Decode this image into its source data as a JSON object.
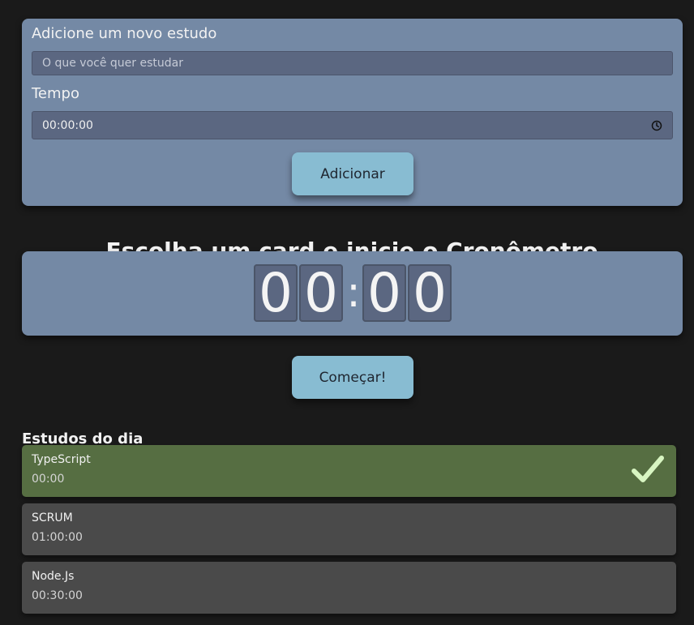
{
  "form": {
    "study_label": "Adicione um novo estudo",
    "study_placeholder": "O que você quer estudar",
    "time_label": "Tempo",
    "time_value": "00:00:00",
    "add_button": "Adicionar"
  },
  "timer": {
    "title": "Escolha um card e inicie o Cronômetro",
    "digits": [
      "0",
      "0",
      "0",
      "0"
    ],
    "separator": ":",
    "start_button": "Começar!"
  },
  "studies": {
    "title": "Estudos do dia",
    "items": [
      {
        "name": "TypeScript",
        "time": "00:00",
        "completed": true
      },
      {
        "name": "SCRUM",
        "time": "01:00:00",
        "completed": false
      },
      {
        "name": "Node.Js",
        "time": "00:30:00",
        "completed": false
      }
    ]
  },
  "colors": {
    "background": "#1a1a1a",
    "card": "#7489a5",
    "input": "#5b6781",
    "button": "#88bcd2",
    "completed_item": "#566e42",
    "item": "#4a4a4a",
    "checkmark": "#d8f5c2"
  },
  "icons": {
    "time_input": "clock-icon",
    "completed_item": "check-icon"
  }
}
